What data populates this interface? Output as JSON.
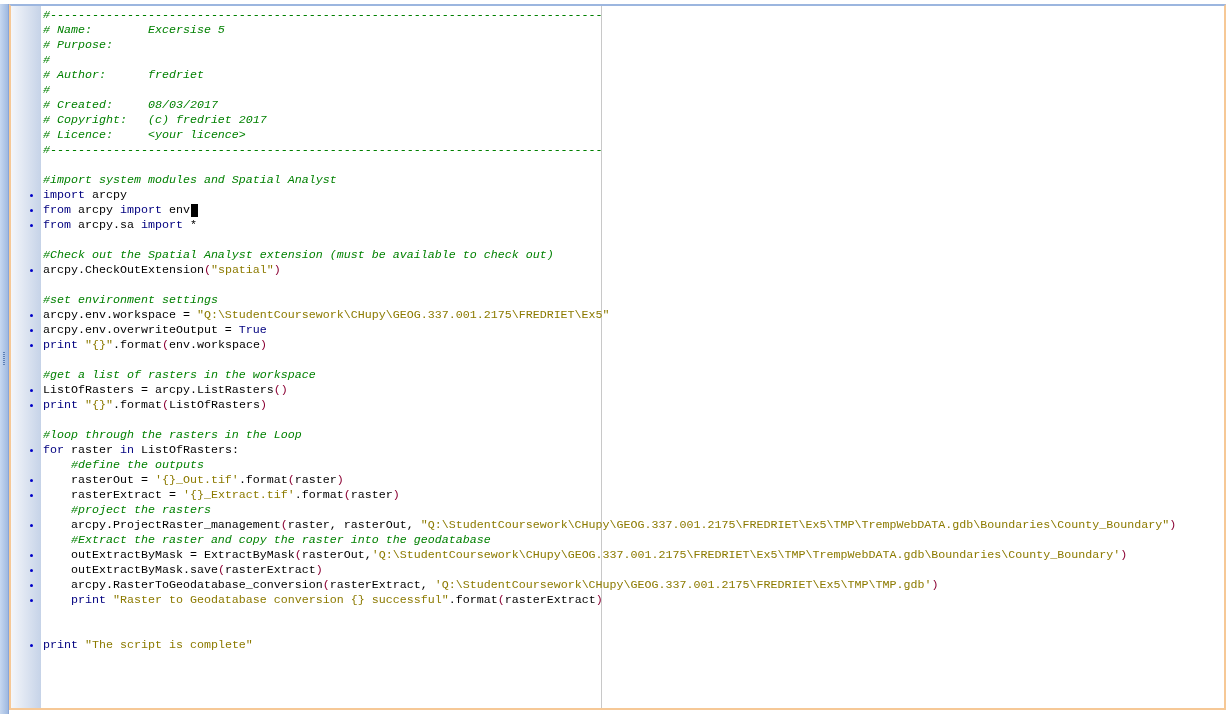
{
  "lines": [
    {
      "kind": "code",
      "tokens": [
        {
          "kind": "comment",
          "text": "#-------------------------------------------------------------------------------"
        }
      ]
    },
    {
      "kind": "code",
      "tokens": [
        {
          "kind": "comment",
          "text": "# Name:        Excersise 5"
        }
      ]
    },
    {
      "kind": "code",
      "tokens": [
        {
          "kind": "comment",
          "text": "# Purpose:"
        }
      ]
    },
    {
      "kind": "code",
      "tokens": [
        {
          "kind": "comment",
          "text": "#"
        }
      ]
    },
    {
      "kind": "code",
      "tokens": [
        {
          "kind": "comment",
          "text": "# Author:      fredriet"
        }
      ]
    },
    {
      "kind": "code",
      "tokens": [
        {
          "kind": "comment",
          "text": "#"
        }
      ]
    },
    {
      "kind": "code",
      "tokens": [
        {
          "kind": "comment",
          "text": "# Created:     08/03/2017"
        }
      ]
    },
    {
      "kind": "code",
      "tokens": [
        {
          "kind": "comment",
          "text": "# Copyright:   (c) fredriet 2017"
        }
      ]
    },
    {
      "kind": "code",
      "tokens": [
        {
          "kind": "comment",
          "text": "# Licence:     <your licence>"
        }
      ]
    },
    {
      "kind": "code",
      "tokens": [
        {
          "kind": "comment",
          "text": "#-------------------------------------------------------------------------------"
        }
      ]
    },
    {
      "kind": "blank"
    },
    {
      "kind": "code",
      "tokens": [
        {
          "kind": "comment",
          "text": "#import system modules and Spatial Analyst"
        }
      ]
    },
    {
      "kind": "code",
      "marker": true,
      "tokens": [
        {
          "kind": "keyword",
          "text": "import"
        },
        {
          "kind": "plain",
          "text": " arcpy"
        }
      ]
    },
    {
      "kind": "code",
      "marker": true,
      "caret": true,
      "tokens": [
        {
          "kind": "keyword",
          "text": "from"
        },
        {
          "kind": "plain",
          "text": " arcpy "
        },
        {
          "kind": "keyword",
          "text": "import"
        },
        {
          "kind": "plain",
          "text": " env"
        }
      ]
    },
    {
      "kind": "code",
      "marker": true,
      "tokens": [
        {
          "kind": "keyword",
          "text": "from"
        },
        {
          "kind": "plain",
          "text": " arcpy.sa "
        },
        {
          "kind": "keyword",
          "text": "import"
        },
        {
          "kind": "plain",
          "text": " *"
        }
      ]
    },
    {
      "kind": "blank"
    },
    {
      "kind": "code",
      "tokens": [
        {
          "kind": "comment",
          "text": "#Check out the Spatial Analyst extension (must be available to check out)"
        }
      ]
    },
    {
      "kind": "code",
      "marker": true,
      "tokens": [
        {
          "kind": "plain",
          "text": "arcpy.CheckOutExtension"
        },
        {
          "kind": "paren",
          "text": "("
        },
        {
          "kind": "string",
          "text": "\"spatial\""
        },
        {
          "kind": "paren",
          "text": ")"
        }
      ]
    },
    {
      "kind": "blank"
    },
    {
      "kind": "code",
      "tokens": [
        {
          "kind": "comment",
          "text": "#set environment settings"
        }
      ]
    },
    {
      "kind": "code",
      "marker": true,
      "tokens": [
        {
          "kind": "plain",
          "text": "arcpy.env.workspace = "
        },
        {
          "kind": "string",
          "text": "\"Q:\\StudentCoursework\\CHupy\\GEOG.337.001.2175\\FREDRIET\\Ex5\""
        }
      ]
    },
    {
      "kind": "code",
      "marker": true,
      "tokens": [
        {
          "kind": "plain",
          "text": "arcpy.env.overwriteOutput = "
        },
        {
          "kind": "keyword",
          "text": "True"
        }
      ]
    },
    {
      "kind": "code",
      "marker": true,
      "tokens": [
        {
          "kind": "keyword",
          "text": "print "
        },
        {
          "kind": "string",
          "text": "\"{}\""
        },
        {
          "kind": "plain",
          "text": ".format"
        },
        {
          "kind": "paren",
          "text": "("
        },
        {
          "kind": "plain",
          "text": "env.workspace"
        },
        {
          "kind": "paren",
          "text": ")"
        }
      ]
    },
    {
      "kind": "blank"
    },
    {
      "kind": "code",
      "tokens": [
        {
          "kind": "comment",
          "text": "#get a list of rasters in the workspace"
        }
      ]
    },
    {
      "kind": "code",
      "marker": true,
      "tokens": [
        {
          "kind": "plain",
          "text": "ListOfRasters = arcpy.ListRasters"
        },
        {
          "kind": "paren",
          "text": "()"
        }
      ]
    },
    {
      "kind": "code",
      "marker": true,
      "tokens": [
        {
          "kind": "keyword",
          "text": "print "
        },
        {
          "kind": "string",
          "text": "\"{}\""
        },
        {
          "kind": "plain",
          "text": ".format"
        },
        {
          "kind": "paren",
          "text": "("
        },
        {
          "kind": "plain",
          "text": "ListOfRasters"
        },
        {
          "kind": "paren",
          "text": ")"
        }
      ]
    },
    {
      "kind": "blank"
    },
    {
      "kind": "code",
      "tokens": [
        {
          "kind": "comment",
          "text": "#loop through the rasters in the Loop"
        }
      ]
    },
    {
      "kind": "code",
      "marker": true,
      "tokens": [
        {
          "kind": "keyword",
          "text": "for"
        },
        {
          "kind": "plain",
          "text": " raster "
        },
        {
          "kind": "keyword",
          "text": "in"
        },
        {
          "kind": "plain",
          "text": " ListOfRasters:"
        }
      ]
    },
    {
      "kind": "code",
      "tokens": [
        {
          "kind": "comment",
          "text": "    #define the outputs"
        }
      ]
    },
    {
      "kind": "code",
      "marker": true,
      "tokens": [
        {
          "kind": "plain",
          "text": "    rasterOut = "
        },
        {
          "kind": "string",
          "text": "'{}_Out.tif'"
        },
        {
          "kind": "plain",
          "text": ".format"
        },
        {
          "kind": "paren",
          "text": "("
        },
        {
          "kind": "plain",
          "text": "raster"
        },
        {
          "kind": "paren",
          "text": ")"
        }
      ]
    },
    {
      "kind": "code",
      "marker": true,
      "tokens": [
        {
          "kind": "plain",
          "text": "    rasterExtract = "
        },
        {
          "kind": "string",
          "text": "'{}_Extract.tif'"
        },
        {
          "kind": "plain",
          "text": ".format"
        },
        {
          "kind": "paren",
          "text": "("
        },
        {
          "kind": "plain",
          "text": "raster"
        },
        {
          "kind": "paren",
          "text": ")"
        }
      ]
    },
    {
      "kind": "code",
      "tokens": [
        {
          "kind": "comment",
          "text": "    #project the rasters"
        }
      ]
    },
    {
      "kind": "code",
      "marker": true,
      "tokens": [
        {
          "kind": "plain",
          "text": "    arcpy.ProjectRaster_management"
        },
        {
          "kind": "paren",
          "text": "("
        },
        {
          "kind": "plain",
          "text": "raster, rasterOut, "
        },
        {
          "kind": "string",
          "text": "\"Q:\\StudentCoursework\\CHupy\\GEOG.337.001.2175\\FREDRIET\\Ex5\\TMP\\TrempWebDATA.gdb\\Boundaries\\County_Boundary\""
        },
        {
          "kind": "paren",
          "text": ")"
        }
      ]
    },
    {
      "kind": "code",
      "tokens": [
        {
          "kind": "comment",
          "text": "    #Extract the raster and copy the raster into the geodatabase"
        }
      ]
    },
    {
      "kind": "code",
      "marker": true,
      "tokens": [
        {
          "kind": "plain",
          "text": "    outExtractByMask = ExtractByMask"
        },
        {
          "kind": "paren",
          "text": "("
        },
        {
          "kind": "plain",
          "text": "rasterOut,"
        },
        {
          "kind": "string",
          "text": "'Q:\\StudentCoursework\\CHupy\\GEOG.337.001.2175\\FREDRIET\\Ex5\\TMP\\TrempWebDATA.gdb\\Boundaries\\County_Boundary'"
        },
        {
          "kind": "paren",
          "text": ")"
        }
      ]
    },
    {
      "kind": "code",
      "marker": true,
      "tokens": [
        {
          "kind": "plain",
          "text": "    outExtractByMask.save"
        },
        {
          "kind": "paren",
          "text": "("
        },
        {
          "kind": "plain",
          "text": "rasterExtract"
        },
        {
          "kind": "paren",
          "text": ")"
        }
      ]
    },
    {
      "kind": "code",
      "marker": true,
      "tokens": [
        {
          "kind": "plain",
          "text": "    arcpy.RasterToGeodatabase_conversion"
        },
        {
          "kind": "paren",
          "text": "("
        },
        {
          "kind": "plain",
          "text": "rasterExtract, "
        },
        {
          "kind": "string",
          "text": "'Q:\\StudentCoursework\\CHupy\\GEOG.337.001.2175\\FREDRIET\\Ex5\\TMP\\TMP.gdb'"
        },
        {
          "kind": "paren",
          "text": ")"
        }
      ]
    },
    {
      "kind": "code",
      "marker": true,
      "tokens": [
        {
          "kind": "keyword",
          "text": "    print "
        },
        {
          "kind": "string",
          "text": "\"Raster to Geodatabase conversion {} successful\""
        },
        {
          "kind": "plain",
          "text": ".format"
        },
        {
          "kind": "paren",
          "text": "("
        },
        {
          "kind": "plain",
          "text": "rasterExtract"
        },
        {
          "kind": "paren",
          "text": ")"
        }
      ]
    },
    {
      "kind": "blank"
    },
    {
      "kind": "blank"
    },
    {
      "kind": "code",
      "marker": true,
      "tokens": [
        {
          "kind": "keyword",
          "text": "print "
        },
        {
          "kind": "string",
          "text": "\"The script is complete\""
        }
      ]
    }
  ]
}
